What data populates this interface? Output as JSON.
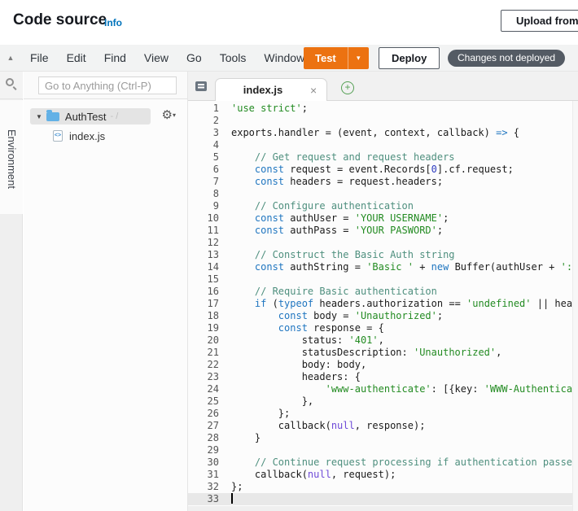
{
  "header": {
    "title": "Code source",
    "info_label": "Info",
    "upload_button": "Upload from"
  },
  "menubar": {
    "items": [
      "File",
      "Edit",
      "Find",
      "View",
      "Go",
      "Tools",
      "Window"
    ],
    "test_button": "Test",
    "deploy_button": "Deploy",
    "status_badge": "Changes not deployed"
  },
  "icons": {
    "collapse": "▲",
    "caret_down": "▾",
    "tree_caret": "▼",
    "gear": "⚙",
    "close": "×",
    "plus": "+",
    "file_glyph": "<>"
  },
  "sidebar": {
    "search_placeholder": "Go to Anything (Ctrl-P)",
    "environment_tab": "Environment",
    "tree": {
      "folder": "AuthTest",
      "folder_suffix": "- /",
      "file": "index.js"
    }
  },
  "editor": {
    "tab": "index.js",
    "lines": [
      {
        "n": 1,
        "t": [
          [
            "str",
            "'use strict'"
          ],
          [
            "pln",
            ";"
          ]
        ]
      },
      {
        "n": 2,
        "t": []
      },
      {
        "n": 3,
        "t": [
          [
            "pln",
            "exports.handler = (event, context, callback) "
          ],
          [
            "kw",
            "=>"
          ],
          [
            "pln",
            " {"
          ]
        ]
      },
      {
        "n": 4,
        "t": []
      },
      {
        "n": 5,
        "t": [
          [
            "com",
            "    // Get request and request headers"
          ]
        ]
      },
      {
        "n": 6,
        "t": [
          [
            "pln",
            "    "
          ],
          [
            "kw",
            "const"
          ],
          [
            "pln",
            " request = event.Records["
          ],
          [
            "num",
            "0"
          ],
          [
            "pln",
            "].cf.request;"
          ]
        ]
      },
      {
        "n": 7,
        "t": [
          [
            "pln",
            "    "
          ],
          [
            "kw",
            "const"
          ],
          [
            "pln",
            " headers = request.headers;"
          ]
        ]
      },
      {
        "n": 8,
        "t": []
      },
      {
        "n": 9,
        "t": [
          [
            "com",
            "    // Configure authentication"
          ]
        ]
      },
      {
        "n": 10,
        "t": [
          [
            "pln",
            "    "
          ],
          [
            "kw",
            "const"
          ],
          [
            "pln",
            " authUser = "
          ],
          [
            "str",
            "'YOUR USERNAME'"
          ],
          [
            "pln",
            ";"
          ]
        ]
      },
      {
        "n": 11,
        "t": [
          [
            "pln",
            "    "
          ],
          [
            "kw",
            "const"
          ],
          [
            "pln",
            " authPass = "
          ],
          [
            "str",
            "'YOUR PASWORD'"
          ],
          [
            "pln",
            ";"
          ]
        ]
      },
      {
        "n": 12,
        "t": []
      },
      {
        "n": 13,
        "t": [
          [
            "com",
            "    // Construct the Basic Auth string"
          ]
        ]
      },
      {
        "n": 14,
        "t": [
          [
            "pln",
            "    "
          ],
          [
            "kw",
            "const"
          ],
          [
            "pln",
            " authString = "
          ],
          [
            "str",
            "'Basic '"
          ],
          [
            "pln",
            " + "
          ],
          [
            "kw",
            "new"
          ],
          [
            "pln",
            " Buffer(authUser + "
          ],
          [
            "str",
            "':'"
          ]
        ]
      },
      {
        "n": 15,
        "t": []
      },
      {
        "n": 16,
        "t": [
          [
            "com",
            "    // Require Basic authentication"
          ]
        ]
      },
      {
        "n": 17,
        "t": [
          [
            "pln",
            "    "
          ],
          [
            "kw",
            "if"
          ],
          [
            "pln",
            " ("
          ],
          [
            "kw",
            "typeof"
          ],
          [
            "pln",
            " headers.authorization == "
          ],
          [
            "str",
            "'undefined'"
          ],
          [
            "pln",
            " || head"
          ]
        ]
      },
      {
        "n": 18,
        "t": [
          [
            "pln",
            "        "
          ],
          [
            "kw",
            "const"
          ],
          [
            "pln",
            " body = "
          ],
          [
            "str",
            "'Unauthorized'"
          ],
          [
            "pln",
            ";"
          ]
        ]
      },
      {
        "n": 19,
        "t": [
          [
            "pln",
            "        "
          ],
          [
            "kw",
            "const"
          ],
          [
            "pln",
            " response = {"
          ]
        ]
      },
      {
        "n": 20,
        "t": [
          [
            "pln",
            "            status: "
          ],
          [
            "str",
            "'401'"
          ],
          [
            "pln",
            ","
          ]
        ]
      },
      {
        "n": 21,
        "t": [
          [
            "pln",
            "            statusDescription: "
          ],
          [
            "str",
            "'Unauthorized'"
          ],
          [
            "pln",
            ","
          ]
        ]
      },
      {
        "n": 22,
        "t": [
          [
            "pln",
            "            body: body,"
          ]
        ]
      },
      {
        "n": 23,
        "t": [
          [
            "pln",
            "            headers: {"
          ]
        ]
      },
      {
        "n": 24,
        "t": [
          [
            "pln",
            "                "
          ],
          [
            "str",
            "'www-authenticate'"
          ],
          [
            "pln",
            ": [{key: "
          ],
          [
            "str",
            "'WWW-Authenticat"
          ]
        ]
      },
      {
        "n": 25,
        "t": [
          [
            "pln",
            "            },"
          ]
        ]
      },
      {
        "n": 26,
        "t": [
          [
            "pln",
            "        };"
          ]
        ]
      },
      {
        "n": 27,
        "t": [
          [
            "pln",
            "        callback("
          ],
          [
            "nul",
            "null"
          ],
          [
            "pln",
            ", response);"
          ]
        ]
      },
      {
        "n": 28,
        "t": [
          [
            "pln",
            "    }"
          ]
        ]
      },
      {
        "n": 29,
        "t": []
      },
      {
        "n": 30,
        "t": [
          [
            "com",
            "    // Continue request processing if authentication passed"
          ]
        ]
      },
      {
        "n": 31,
        "t": [
          [
            "pln",
            "    callback("
          ],
          [
            "nul",
            "null"
          ],
          [
            "pln",
            ", request);"
          ]
        ]
      },
      {
        "n": 32,
        "t": [
          [
            "pln",
            "};"
          ]
        ]
      },
      {
        "n": 33,
        "t": [],
        "active": true,
        "cursor": true
      }
    ]
  },
  "colors": {
    "accent_orange": "#ec7211",
    "link_blue": "#0073bb",
    "badge_bg": "#545b64",
    "keyword": "#2076c0",
    "string": "#238b22",
    "comment": "#4e8f7e",
    "number": "#2d3bbf",
    "null_keyword": "#6f4bd8"
  }
}
